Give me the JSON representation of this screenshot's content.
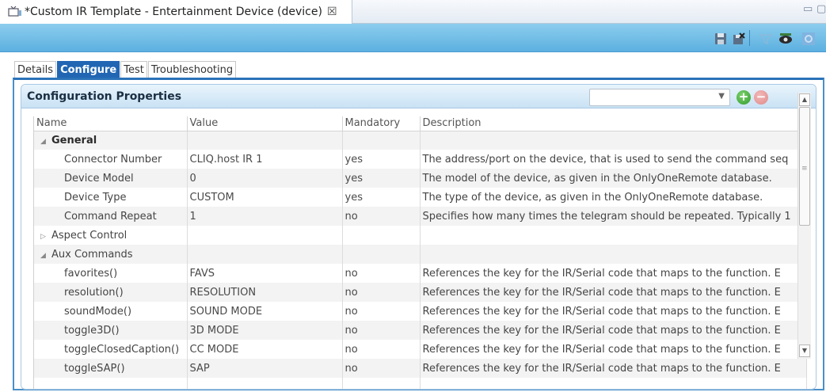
{
  "editor": {
    "title": "*Custom IR Template - Entertainment Device (device)",
    "close_glyph": "☒",
    "minimize_glyph": "▭",
    "maximize_glyph": "▢"
  },
  "toolbar": {
    "icons": [
      "save-icon",
      "revert-icon",
      "filter-icon",
      "preview-icon",
      "settings-icon"
    ]
  },
  "subtabs": [
    "Details",
    "Configure",
    "Test",
    "Troubleshooting"
  ],
  "panel": {
    "title": "Configuration Properties",
    "filter_value": "",
    "add_glyph": "+",
    "remove_glyph": "−"
  },
  "columns": [
    "Name",
    "Value",
    "Mandatory",
    "Description"
  ],
  "rows": [
    {
      "name": "General",
      "value": "",
      "mandatory": "",
      "description": "",
      "level": 0,
      "expander": "◢",
      "bold": true
    },
    {
      "name": "Connector Number",
      "value": "CLIQ.host IR 1",
      "mandatory": "yes",
      "description": "The address/port on the device, that is used to send the command seq",
      "level": 2
    },
    {
      "name": "Device Model",
      "value": "0",
      "mandatory": "yes",
      "description": "The model of the device, as given in the OnlyOneRemote database.",
      "level": 2
    },
    {
      "name": "Device Type",
      "value": "CUSTOM",
      "mandatory": "yes",
      "description": "The type of the device, as given in the OnlyOneRemote database.",
      "level": 2
    },
    {
      "name": "Command Repeat",
      "value": "1",
      "mandatory": "no",
      "description": "Specifies how many times the telegram should be repeated. Typically 1",
      "level": 2
    },
    {
      "name": "Aspect Control",
      "value": "",
      "mandatory": "",
      "description": "",
      "level": 0,
      "expander": "▷",
      "bold": false
    },
    {
      "name": "Aux Commands",
      "value": "",
      "mandatory": "",
      "description": "",
      "level": 0,
      "expander": "◢",
      "bold": false
    },
    {
      "name": "favorites()",
      "value": "FAVS",
      "mandatory": "no",
      "description": "References the key for the IR/Serial code that maps to the function. E",
      "level": 1
    },
    {
      "name": "resolution()",
      "value": "RESOLUTION",
      "mandatory": "no",
      "description": "References the key for the IR/Serial code that maps to the function. E",
      "level": 1
    },
    {
      "name": "soundMode()",
      "value": "SOUND MODE",
      "mandatory": "no",
      "description": "References the key for the IR/Serial code that maps to the function. E",
      "level": 1
    },
    {
      "name": "toggle3D()",
      "value": "3D MODE",
      "mandatory": "no",
      "description": "References the key for the IR/Serial code that maps to the function. E",
      "level": 1
    },
    {
      "name": "toggleClosedCaption()",
      "value": "CC MODE",
      "mandatory": "no",
      "description": "References the key for the IR/Serial code that maps to the function. E",
      "level": 1
    },
    {
      "name": "toggleSAP()",
      "value": "SAP",
      "mandatory": "no",
      "description": "References the key for the IR/Serial code that maps to the function. E",
      "level": 1
    },
    {
      "name": "",
      "value": "",
      "mandatory": "",
      "description": "",
      "level": 1
    }
  ],
  "colors": {
    "toolbar_blue": "#6fbfe8",
    "active_tab": "#2166b3",
    "frame_border": "#4a90c8"
  }
}
